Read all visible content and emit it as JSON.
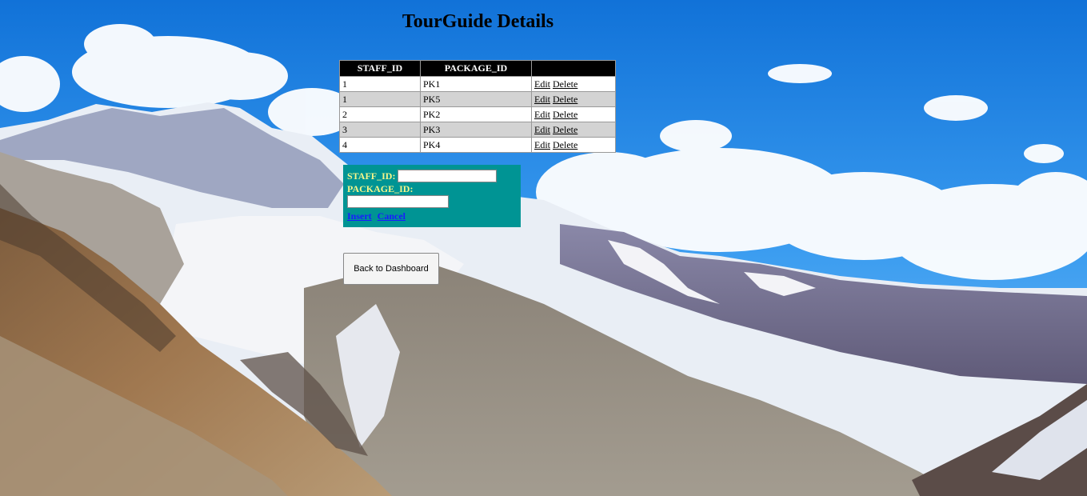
{
  "page": {
    "title": "TourGuide Details"
  },
  "grid": {
    "columns": [
      "STAFF_ID",
      "PACKAGE_ID",
      ""
    ],
    "rows": [
      {
        "staff_id": "1",
        "package_id": "PK1",
        "edit": "Edit",
        "delete": "Delete"
      },
      {
        "staff_id": "1",
        "package_id": "PK5",
        "edit": "Edit",
        "delete": "Delete"
      },
      {
        "staff_id": "2",
        "package_id": "PK2",
        "edit": "Edit",
        "delete": "Delete"
      },
      {
        "staff_id": "3",
        "package_id": "PK3",
        "edit": "Edit",
        "delete": "Delete"
      },
      {
        "staff_id": "4",
        "package_id": "PK4",
        "edit": "Edit",
        "delete": "Delete"
      }
    ],
    "colors": {
      "header_bg": "#000000",
      "header_text": "#ffffff",
      "alt_row_bg": "#d3d3d3"
    }
  },
  "insert_form": {
    "staff_id_label": "STAFF_ID:",
    "staff_id_value": "",
    "package_id_label": "PACKAGE_ID:",
    "package_id_value": "",
    "insert_label": "Insert",
    "cancel_label": "Cancel",
    "colors": {
      "background": "#009494",
      "label_text": "#f5f58a",
      "link": "#1a1aff"
    }
  },
  "actions": {
    "back_label": "Back to Dashboard"
  },
  "background": {
    "description_icon": "mountain-landscape-image"
  }
}
